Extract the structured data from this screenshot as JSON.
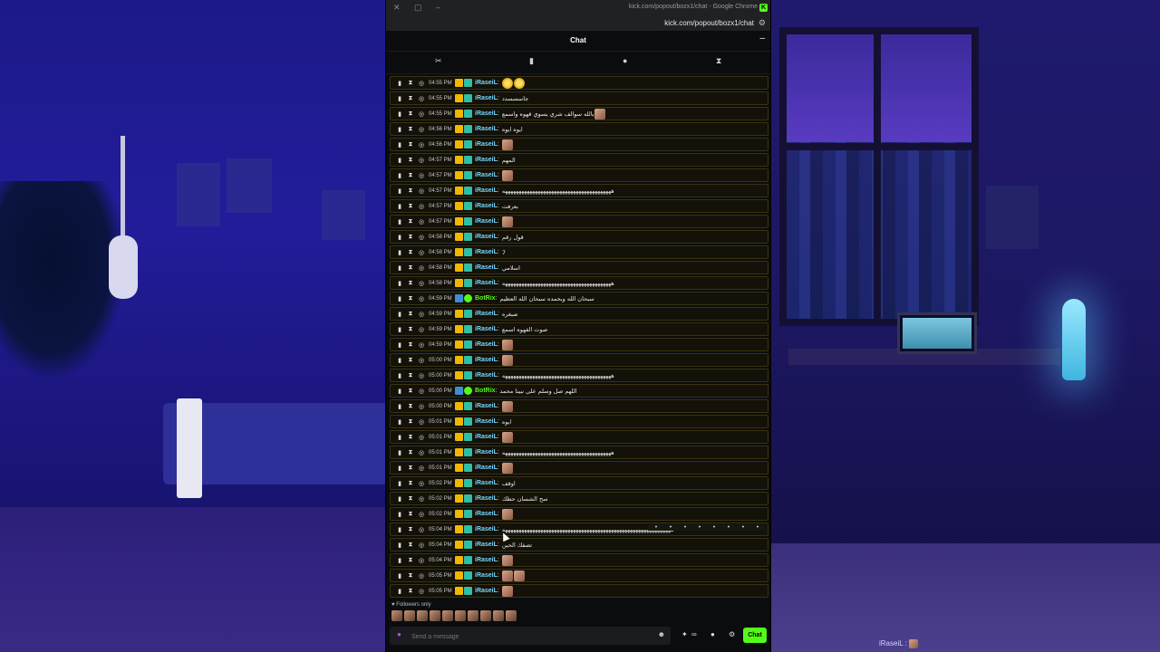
{
  "window": {
    "title": "kick.com/popout/bozx1/chat - Google Chrome",
    "url": "kick.com/popout/bozx1/chat"
  },
  "chat": {
    "header_title": "Chat",
    "followers_label": "Followers only",
    "input_placeholder": "Send a message",
    "send_label": "Chat"
  },
  "messages": [
    {
      "time": "04:55 PM",
      "user": "iRaseiL",
      "text": "",
      "emotes": 2,
      "emote_kind": "gold"
    },
    {
      "time": "04:55 PM",
      "user": "iRaseiL",
      "text": "جاسسسدد",
      "emotes": 0
    },
    {
      "time": "04:55 PM",
      "user": "iRaseiL",
      "text": "بالله سوالف شري يسوي قهوه واسمع",
      "emotes": 1
    },
    {
      "time": "04:56 PM",
      "user": "iRaseiL",
      "text": "ايوه ايوه",
      "emotes": 0
    },
    {
      "time": "04:56 PM",
      "user": "iRaseiL",
      "text": "",
      "emotes": 1
    },
    {
      "time": "04:57 PM",
      "user": "iRaseiL",
      "text": "المهم",
      "emotes": 0
    },
    {
      "time": "04:57 PM",
      "user": "iRaseiL",
      "text": "",
      "emotes": 1
    },
    {
      "time": "04:57 PM",
      "user": "iRaseiL",
      "text": "ههههههههههههههههههههههههههههههههههههههههه",
      "emotes": 0
    },
    {
      "time": "04:57 PM",
      "user": "iRaseiL",
      "text": "بعرفت",
      "emotes": 0
    },
    {
      "time": "04:57 PM",
      "user": "iRaseiL",
      "text": "",
      "emotes": 1
    },
    {
      "time": "04:58 PM",
      "user": "iRaseiL",
      "text": "قول رقم",
      "emotes": 0
    },
    {
      "time": "04:58 PM",
      "user": "iRaseiL",
      "text": "7",
      "emotes": 0
    },
    {
      "time": "04:58 PM",
      "user": "iRaseiL",
      "text": "اسلامي",
      "emotes": 0
    },
    {
      "time": "04:58 PM",
      "user": "iRaseiL",
      "text": "ههههههههههههههههههههههههههههههههههههههههه",
      "emotes": 0
    },
    {
      "time": "04:59 PM",
      "user": "BotRix",
      "bot": true,
      "text": "سبحان الله وبحمده سبحان الله العظيم",
      "emotes": 0
    },
    {
      "time": "04:59 PM",
      "user": "iRaseiL",
      "text": "صبغره",
      "emotes": 0
    },
    {
      "time": "04:59 PM",
      "user": "iRaseiL",
      "text": "صوت القهوه اسمع",
      "emotes": 0
    },
    {
      "time": "04:59 PM",
      "user": "iRaseiL",
      "text": "",
      "emotes": 1
    },
    {
      "time": "05:00 PM",
      "user": "iRaseiL",
      "text": "",
      "emotes": 1
    },
    {
      "time": "05:00 PM",
      "user": "iRaseiL",
      "text": "ههههههههههههههههههههههههههههههههههههههههه",
      "emotes": 0
    },
    {
      "time": "05:00 PM",
      "user": "BotRix",
      "bot": true,
      "text": "اللهم صل وسلم على نبينا محمد",
      "emotes": 0
    },
    {
      "time": "05:00 PM",
      "user": "iRaseiL",
      "text": "",
      "emotes": 1
    },
    {
      "time": "05:01 PM",
      "user": "iRaseiL",
      "text": "ايوه",
      "emotes": 0
    },
    {
      "time": "05:01 PM",
      "user": "iRaseiL",
      "text": "",
      "emotes": 1
    },
    {
      "time": "05:01 PM",
      "user": "iRaseiL",
      "text": "ههههههههههههههههههههههههههههههههههههههههه",
      "emotes": 0
    },
    {
      "time": "05:01 PM",
      "user": "iRaseiL",
      "text": "",
      "emotes": 1
    },
    {
      "time": "05:02 PM",
      "user": "iRaseiL",
      "text": "اوقف",
      "emotes": 0
    },
    {
      "time": "05:02 PM",
      "user": "iRaseiL",
      "text": "سح الشسان حطك",
      "emotes": 0
    },
    {
      "time": "05:02 PM",
      "user": "iRaseiL",
      "text": "",
      "emotes": 1
    },
    {
      "time": "05:04 PM",
      "user": "iRaseiL",
      "text": "ههههههههههههههههههههههههههههههههههههههههههههههههههههههههههههههه",
      "emotes": 0,
      "hover": true
    },
    {
      "time": "05:04 PM",
      "user": "iRaseiL",
      "text": "تصفك الحين",
      "emotes": 0
    },
    {
      "time": "05:04 PM",
      "user": "iRaseiL",
      "text": "",
      "emotes": 1
    },
    {
      "time": "05:05 PM",
      "user": "iRaseiL",
      "text": "",
      "emotes": 2
    },
    {
      "time": "05:05 PM",
      "user": "iRaseiL",
      "text": "",
      "emotes": 1
    }
  ],
  "emote_picker_count": 10,
  "overlay": {
    "corner_user": "iRaseiL :"
  },
  "icons": {
    "titlebar": [
      "close-icon",
      "maximize-icon",
      "minimize-icon"
    ],
    "mod_toolbar": [
      "pin-icon",
      "trash-icon",
      "chat-bubble-icon",
      "timeout-icon"
    ],
    "hover_tools": [
      "reply-icon",
      "clock-icon",
      "pin-slash-icon",
      "chat-bubble-icon",
      "delete-icon",
      "undo-icon",
      "pin-icon",
      "trash-icon"
    ]
  },
  "colors": {
    "brand": "#53fc18",
    "username": "#78d8ff"
  }
}
